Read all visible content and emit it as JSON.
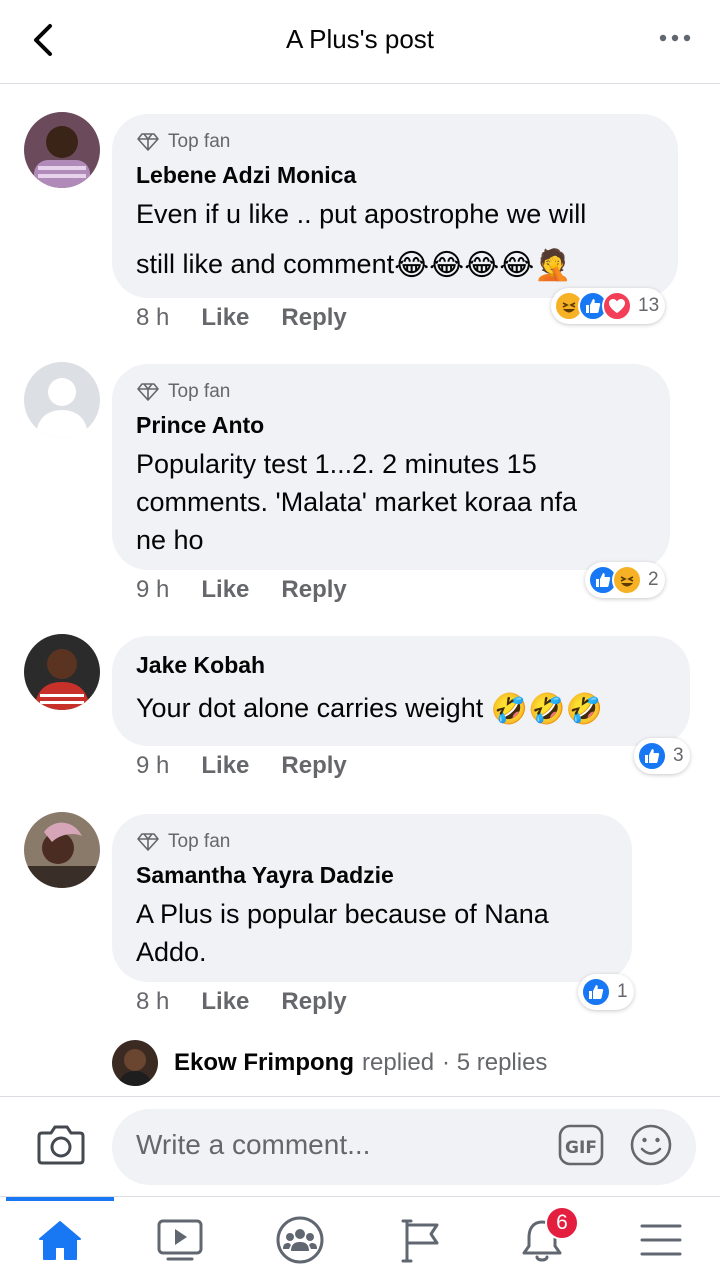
{
  "header": {
    "title": "A Plus's post"
  },
  "comments": [
    {
      "badge": "Top fan",
      "name": "Lebene Adzi Monica",
      "text_line1": "Even if u like .. put apostrophe we will",
      "text_line2": "still like and comment",
      "emojis": "😂😂😂😂🤦",
      "time": "8 h",
      "like": "Like",
      "reply": "Reply",
      "reaction_count": "13"
    },
    {
      "badge": "Top fan",
      "name": "Prince Anto",
      "text_line1": "Popularity test 1...2. 2 minutes 15",
      "text_line2": "comments. 'Malata' market koraa nfa",
      "text_line3": "ne ho",
      "time": "9 h",
      "like": "Like",
      "reply": "Reply",
      "reaction_count": "2"
    },
    {
      "name": "Jake Kobah",
      "text_line1": "Your dot alone carries weight",
      "emojis": "🤣🤣🤣",
      "time": "9 h",
      "like": "Like",
      "reply": "Reply",
      "reaction_count": "3"
    },
    {
      "badge": "Top fan",
      "name": "Samantha Yayra Dadzie",
      "text_line1": "A Plus is popular because of Nana",
      "text_line2": "Addo.",
      "time": "8 h",
      "like": "Like",
      "reply": "Reply",
      "reaction_count": "1"
    }
  ],
  "replies_row": {
    "name": "Ekow Frimpong",
    "action": "replied",
    "count": "· 5 replies"
  },
  "composer": {
    "placeholder": "Write a comment...",
    "gif_label": "GIF"
  },
  "tabbar": {
    "notifications_badge": "6"
  },
  "colors": {
    "accent": "#1877f2",
    "bubble": "#f0f2f5",
    "muted": "#65676b",
    "badge": "#e41e3f"
  }
}
